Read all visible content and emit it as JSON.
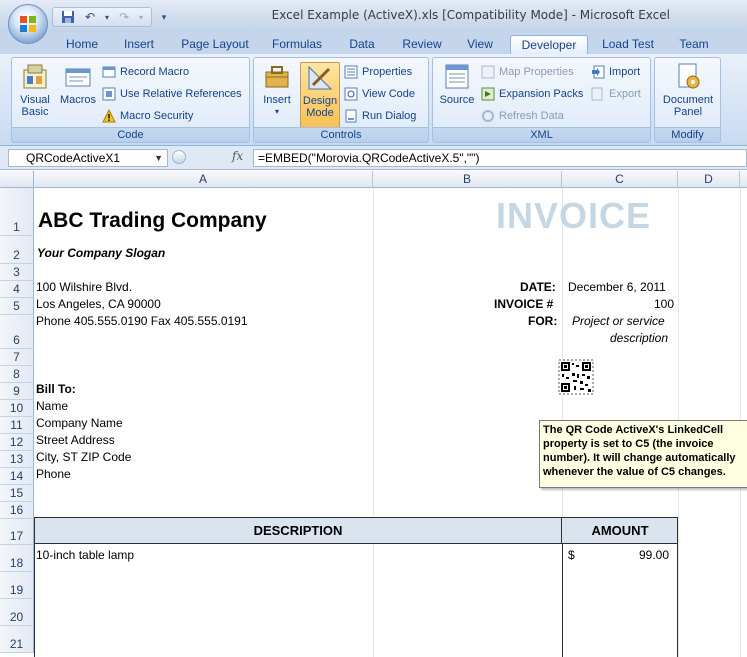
{
  "window": {
    "title": "Excel Example (ActiveX).xls  [Compatibility Mode] - Microsoft Excel"
  },
  "ribbon": {
    "tabs": [
      "Home",
      "Insert",
      "Page Layout",
      "Formulas",
      "Data",
      "Review",
      "View",
      "Developer",
      "Load Test",
      "Team"
    ],
    "active_tab": "Developer",
    "groups": {
      "code": {
        "label": "Code",
        "visual_basic": "Visual Basic",
        "macros": "Macros",
        "record_macro": "Record Macro",
        "relative_refs": "Use Relative References",
        "macro_security": "Macro Security"
      },
      "controls": {
        "label": "Controls",
        "insert": "Insert",
        "design_mode": "Design Mode",
        "properties": "Properties",
        "view_code": "View Code",
        "run_dialog": "Run Dialog"
      },
      "xml": {
        "label": "XML",
        "source": "Source",
        "map_properties": "Map Properties",
        "expansion_packs": "Expansion Packs",
        "refresh_data": "Refresh Data",
        "import": "Import",
        "export": "Export"
      },
      "modify": {
        "label": "Modify",
        "document_panel": "Document Panel"
      }
    }
  },
  "formula_bar": {
    "name_box": "QRCodeActiveX1",
    "fx": "fx",
    "formula": "=EMBED(\"Morovia.QRCodeActiveX.5\",\"\")"
  },
  "sheet": {
    "columns": [
      "A",
      "B",
      "C",
      "D"
    ],
    "rows": [
      "1",
      "2",
      "3",
      "4",
      "5",
      "6",
      "7",
      "8",
      "9",
      "10",
      "11",
      "12",
      "13",
      "14",
      "15",
      "16",
      "17",
      "18",
      "19",
      "20",
      "21"
    ],
    "company_name": "ABC Trading Company",
    "invoice_word": "INVOICE",
    "slogan": "Your Company Slogan",
    "address1": "100 Wilshire Blvd.",
    "address2": "Los Angeles, CA 90000",
    "phone_line": "Phone 405.555.0190   Fax 405.555.0191",
    "date_label": "DATE:",
    "date_value": "December 6, 2011",
    "invoice_no_label": "INVOICE #",
    "invoice_no_value": "100",
    "for_label": "FOR:",
    "for_value1": "Project or service",
    "for_value2": "description",
    "bill_to": "Bill To:",
    "bill_name": "Name",
    "bill_company": "Company Name",
    "bill_street": "Street Address",
    "bill_city": "City, ST  ZIP Code",
    "bill_phone": "Phone",
    "table_header_desc": "DESCRIPTION",
    "table_header_amount": "AMOUNT",
    "item_desc": "10-inch table lamp",
    "item_currency": "$",
    "item_amount": "99.00",
    "note": "The QR Code ActiveX's LinkedCell property is set to C5 (the invoice number). It will change automatically whenever the value of C5 changes."
  }
}
